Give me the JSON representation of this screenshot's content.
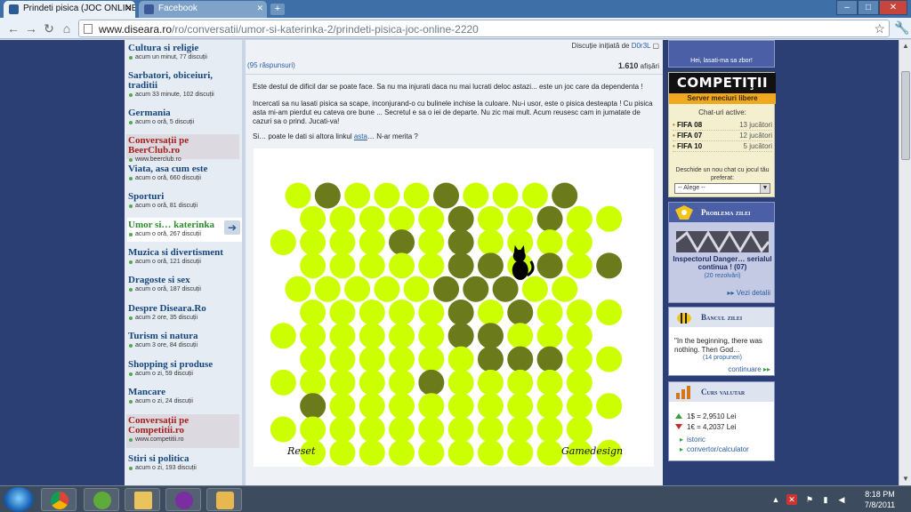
{
  "browser": {
    "tabs": [
      {
        "label": "Prindeti pisica (JOC ONLINE)",
        "active": true
      },
      {
        "label": "Facebook",
        "active": false
      }
    ],
    "new_tab": "+",
    "url_host": "www.diseara.ro",
    "url_path": "/ro/conversatii/umor-si-katerinka-2/prindeti-pisica-joc-online-2220"
  },
  "sidebar": {
    "categories": [
      {
        "title": "Cultura si religie",
        "meta": "acum un minut, 77 discuții"
      },
      {
        "title": "Sarbatori, obiceiuri, traditii",
        "meta": "acum 33 minute, 102 discuții"
      },
      {
        "title": "Germania",
        "meta": "acum o oră, 5 discuții"
      },
      {
        "title": "Conversații pe BeerClub.ro",
        "meta": "www.beerclub.ro",
        "promo": true
      },
      {
        "title": "Viata, asa cum este",
        "meta": "acum o oră, 660 discuții"
      },
      {
        "title": "Sporturi",
        "meta": "acum o oră, 81 discuții"
      },
      {
        "title": "Umor si… katerinka",
        "meta": "acum o oră, 267 discuții",
        "selected": true
      },
      {
        "title": "Muzica si divertisment",
        "meta": "acum o oră, 121 discuții"
      },
      {
        "title": "Dragoste si sex",
        "meta": "acum o oră, 187 discuții"
      },
      {
        "title": "Despre Diseara.Ro",
        "meta": "acum 2 ore, 35 discuții"
      },
      {
        "title": "Turism si natura",
        "meta": "acum 3 ore, 84 discuții"
      },
      {
        "title": "Shopping si produse",
        "meta": "acum o zi, 59 discuții"
      },
      {
        "title": "Mancare",
        "meta": "acum o zi, 24 discuții"
      },
      {
        "title": "Conversații pe Competitii.ro",
        "meta": "www.competitii.ro",
        "promo": true
      },
      {
        "title": "Stiri si politica",
        "meta": "acum o zi, 193 discuții"
      }
    ]
  },
  "thread": {
    "started_label": "Discuție inițiată de",
    "started_user": "D0r3L",
    "replies": "(95 răspunsuri)",
    "views_count": "1.610",
    "views_label": "afișări",
    "p1": "Este destul de dificil dar se poate face. Sa nu ma injurati daca nu mai lucrati deloc astazi... este un joc care da dependenta !",
    "p2": "Incercati sa nu lasati pisica sa scape, inconjurand-o cu bulinele inchise la culoare. Nu-i usor, este o pisica desteapta ! Cu pisica asta mi-am pierdut eu cateva ore bune ... Secretul e sa o iei de departe. Nu zic mai mult. Acum reusesc cam in jumatate de cazuri sa o prind. Jucati-va!",
    "p3_before": "Si… poate le dati si altora linkul ",
    "p3_link": "asta",
    "p3_after": "… N-ar merita ?"
  },
  "game": {
    "reset_label": "Reset",
    "credit_label": "Gamedesign",
    "light_color": "#ccff00",
    "dark_color": "#6b7a1a",
    "cat_color": "#000000",
    "rows": [
      "ldllldllld",
      "llllldlldll",
      "lllldldllll",
      "lllllddldld",
      "llllldddll",
      "llllldldlll",
      "llllllddlll",
      "lllllldddll",
      "llllldlllll",
      "dllllllllll",
      "lllllllllll",
      "lllllllllll"
    ],
    "cat_row": 3,
    "cat_col": 7
  },
  "right": {
    "top_text": "Hei, lasati-ma sa zbor!",
    "comp_logo": "COMPETIŢII",
    "comp_sub": "Server meciuri libere",
    "chat_title": "Chat-uri active:",
    "chats": [
      {
        "game": "FIFA 08",
        "count": "13 jucători"
      },
      {
        "game": "FIFA 07",
        "count": "12 jucători"
      },
      {
        "game": "FIFA 10",
        "count": "5 jucători"
      }
    ],
    "new_chat": "Deschide un nou chat cu jocul tău preferat:",
    "select_value": "-- Alege --",
    "problem_label": "Problema zilei",
    "problem_title": "Inspectorul Danger… serialul continua ! (07)",
    "problem_sub": "(20 rezolvări)",
    "problem_link": "Vezi detalii",
    "joke_label": "Bancul zilei",
    "joke_text": "\"In the beginning, there was nothing. Then God…",
    "joke_sub": "(14 propuneri)",
    "joke_link": "continuare",
    "curs_label": "Curs valutar",
    "usd": "1$ = 2,9510 Lei",
    "eur": "1€ = 4,2037 Lei",
    "link_istoric": "istoric",
    "link_conv": "convertor/calculator"
  },
  "taskbar": {
    "time": "8:18 PM",
    "date": "7/8/2011"
  }
}
